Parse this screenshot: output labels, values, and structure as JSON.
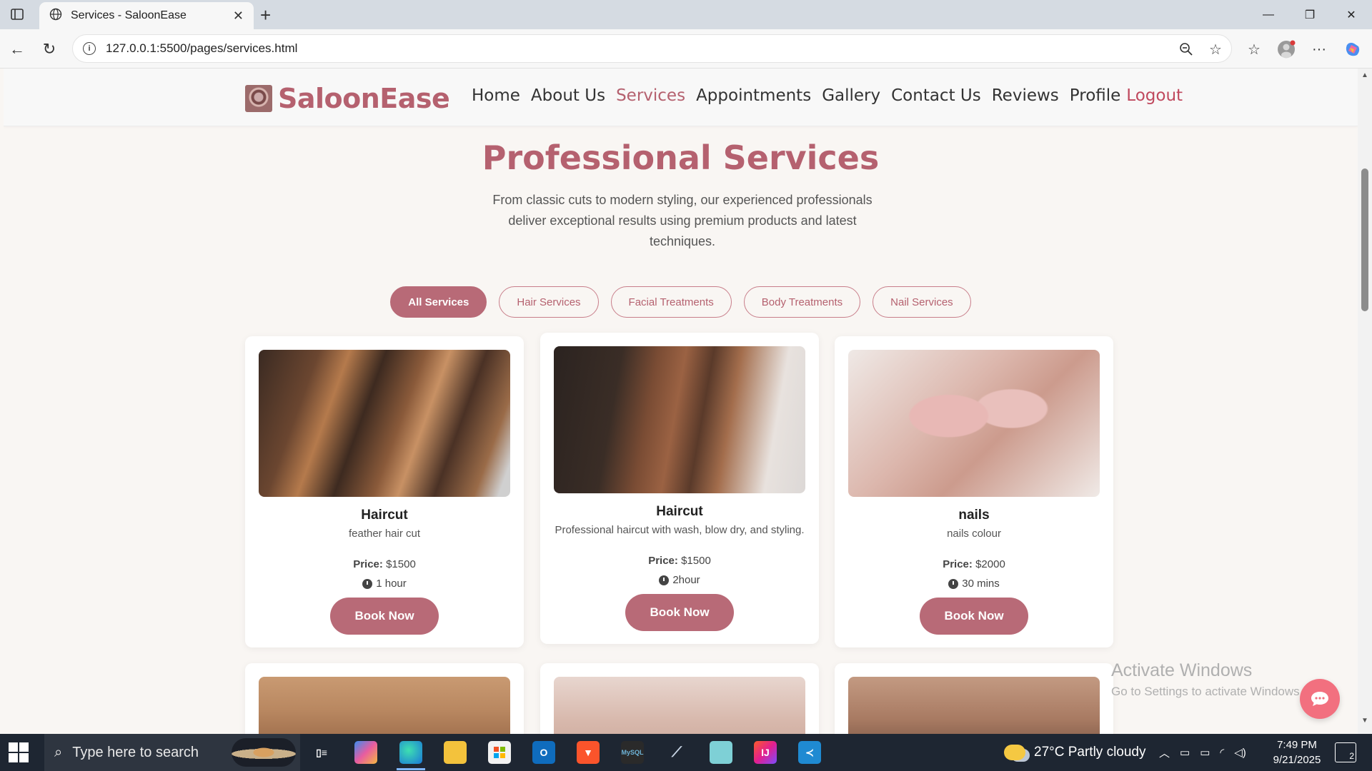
{
  "browser": {
    "tab_title": "Services - SaloonEase",
    "url": "127.0.0.1:5500/pages/services.html"
  },
  "site": {
    "brand": "SaloonEase",
    "nav": [
      "Home",
      "About Us",
      "Services",
      "Appointments",
      "Gallery",
      "Contact Us",
      "Reviews",
      "Profile",
      "Logout"
    ],
    "active_nav": "Services"
  },
  "hero": {
    "title": "Professional Services",
    "subtitle": "From classic cuts to modern styling, our experienced professionals deliver exceptional results using premium products and latest techniques."
  },
  "filters": [
    "All Services",
    "Hair Services",
    "Facial Treatments",
    "Body Treatments",
    "Nail Services"
  ],
  "active_filter": "All Services",
  "services": [
    {
      "title": "Haircut",
      "desc": "feather hair cut",
      "price_label": "Price:",
      "price": "$1500",
      "duration": "1 hour",
      "button": "Book Now"
    },
    {
      "title": "Haircut",
      "desc": "Professional haircut with wash, blow dry, and styling.",
      "price_label": "Price:",
      "price": "$1500",
      "duration": "2hour",
      "button": "Book Now"
    },
    {
      "title": "nails",
      "desc": "nails colour",
      "price_label": "Price:",
      "price": "$2000",
      "duration": "30 mins",
      "button": "Book Now"
    }
  ],
  "watermark": {
    "line1": "Activate Windows",
    "line2": "Go to Settings to activate Windows."
  },
  "taskbar": {
    "search_placeholder": "Type here to search",
    "weather": "27°C  Partly cloudy",
    "time": "7:49 PM",
    "date": "9/21/2025",
    "notifications": "2"
  },
  "colors": {
    "accent": "#b5616f",
    "button": "#b86a77",
    "chat_fab": "#f2707f"
  }
}
